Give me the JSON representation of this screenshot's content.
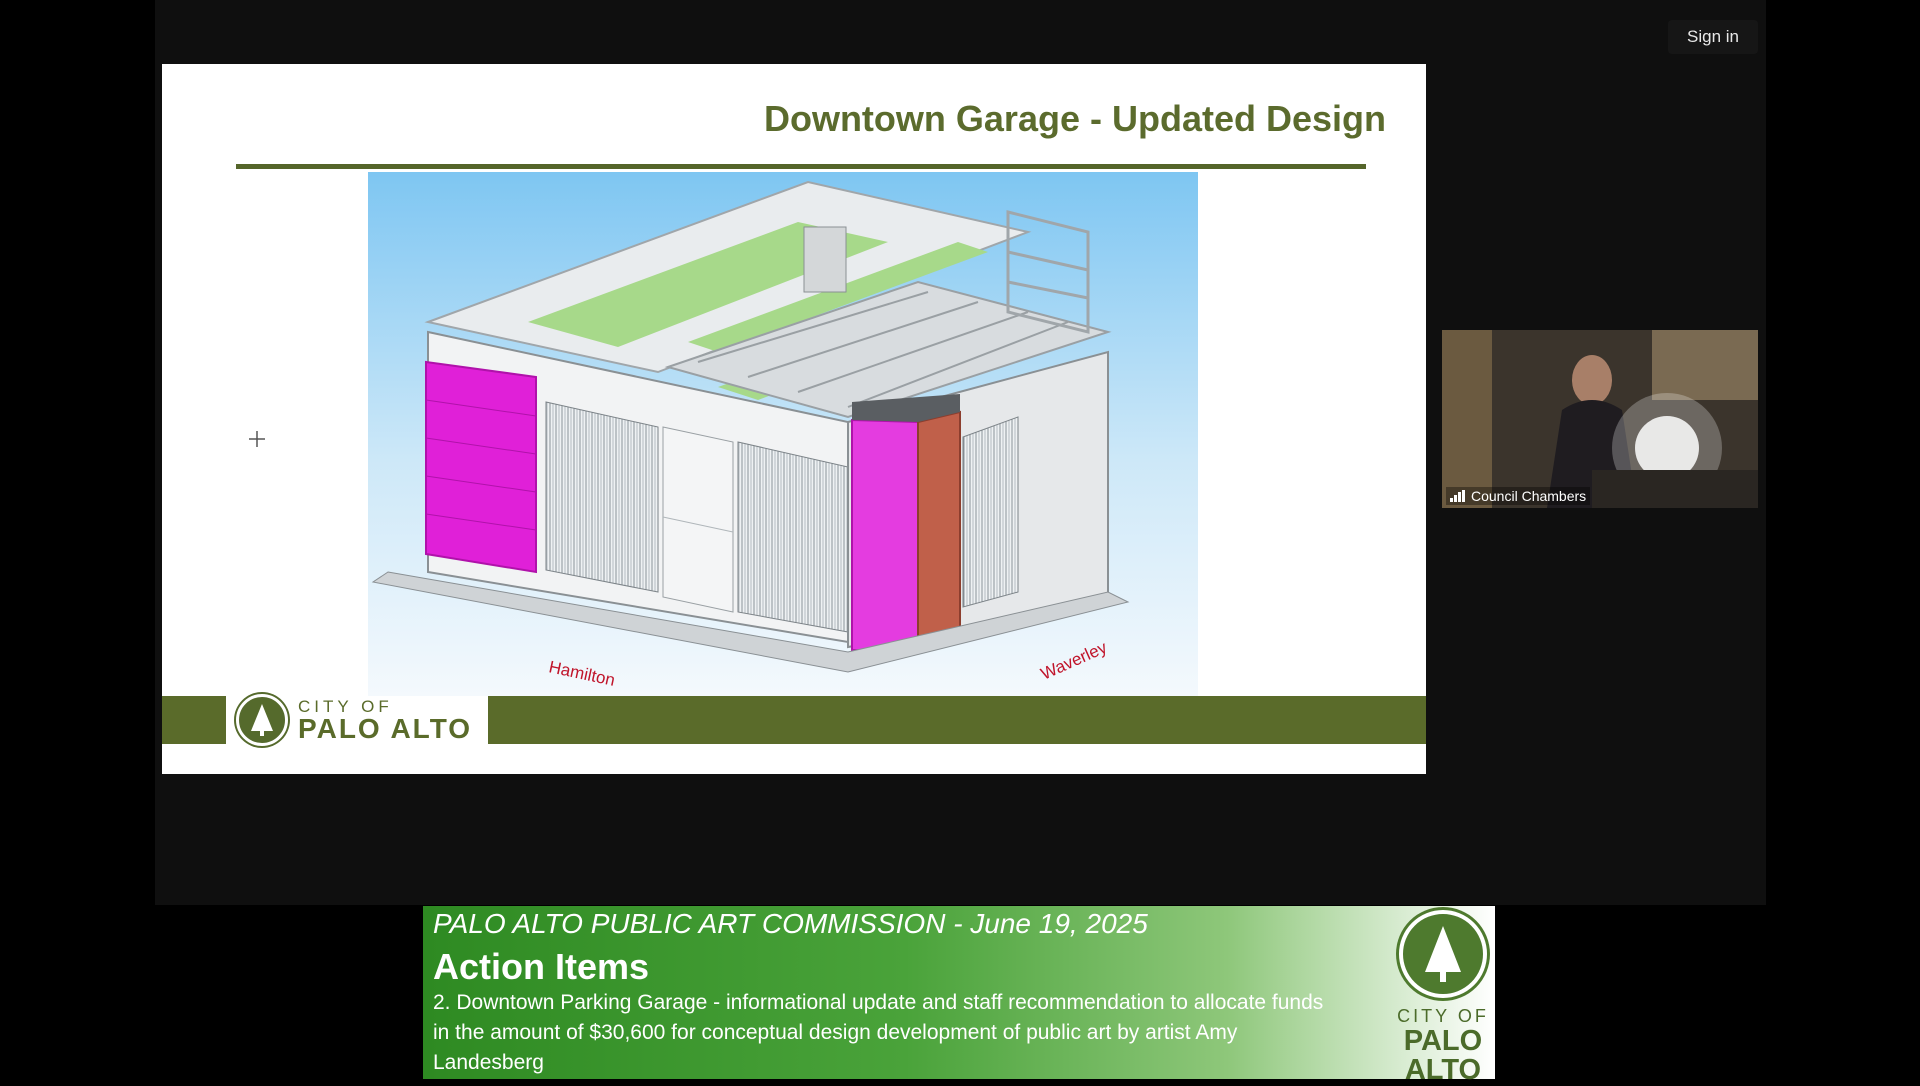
{
  "header": {
    "sign_in_label": "Sign in"
  },
  "slide": {
    "title": "Downtown Garage - Updated Design",
    "street_labels": {
      "left": "Hamilton",
      "right": "Waverley"
    },
    "logo": {
      "city": "CITY OF",
      "name": "PALO ALTO"
    }
  },
  "video": {
    "participant_name": "Council Chambers"
  },
  "banner": {
    "subtitle": "PALO ALTO PUBLIC ART COMMISSION - June 19, 2025",
    "heading": "Action Items",
    "body": "2. Downtown Parking Garage - informational update and staff recommendation to allocate funds in the amount of $30,600 for conceptual design development of public art by artist Amy Landesberg",
    "logo": {
      "city": "CITY OF",
      "name_line1": "PALO",
      "name_line2": "ALTO"
    }
  },
  "colors": {
    "brand_green": "#5a6b2a",
    "accent_magenta": "#e020d8",
    "accent_terracotta": "#c0604a"
  }
}
